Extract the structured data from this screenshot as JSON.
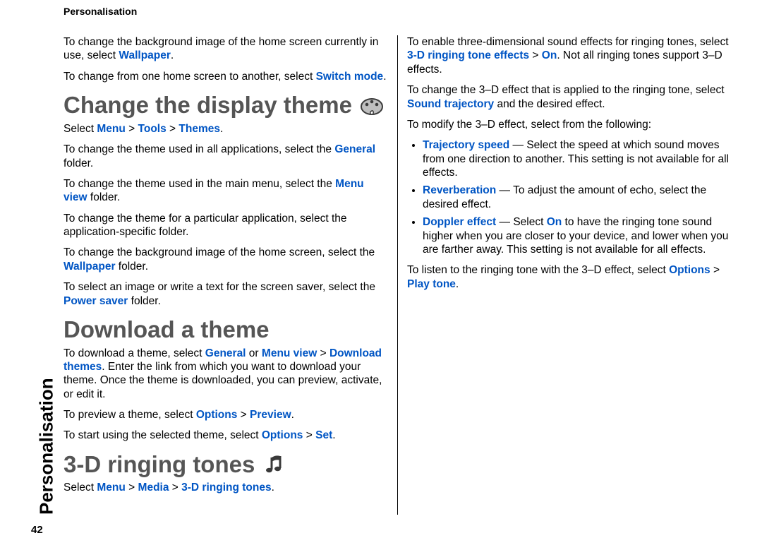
{
  "header": "Personalisation",
  "side_tab": "Personalisation",
  "page_number": "42",
  "intro": {
    "p1a": "To change the background image of the home screen currently in use, select ",
    "p1_link": "Wallpaper",
    "p1b": ".",
    "p2a": "To change from one home screen to another, select ",
    "p2_link": "Switch mode",
    "p2b": "."
  },
  "h1": "Change the display theme",
  "s1": {
    "p1a": "Select ",
    "p1_l1": "Menu",
    "p1_sep": " > ",
    "p1_l2": "Tools",
    "p1_l3": "Themes",
    "p1b": ".",
    "p2a": "To change the theme used in all applications, select the ",
    "p2_l": "General",
    "p2b": " folder.",
    "p3a": "To change the theme used in the main menu, select the ",
    "p3_l": "Menu view",
    "p3b": " folder.",
    "p4": "To change the theme for a particular application, select the application-specific folder.",
    "p5a": "To change the background image of the home screen, select the ",
    "p5_l": "Wallpaper",
    "p5b": " folder.",
    "p6a": "To select an image or write a text for the screen saver, select the ",
    "p6_l": "Power saver",
    "p6b": " folder."
  },
  "h2": "Download a theme",
  "s2": {
    "p1a": "To download a theme, select ",
    "p1_l1": "General",
    "p1_mid": " or ",
    "p1_l2": "Menu view",
    "p1_sep": " > ",
    "p1_l3": "Download themes",
    "p1b": ". Enter the link from which you want to download your theme. Once the theme is downloaded, you can preview, activate, or edit it.",
    "p2a": "To preview a theme, select ",
    "p2_l1": "Options",
    "p2_sep": " > ",
    "p2_l2": "Preview",
    "p2b": ".",
    "p3a": "To start using the selected theme, select ",
    "p3_l1": "Options",
    "p3_sep": " > ",
    "p3_l2": "Set",
    "p3b": "."
  },
  "h3": "3-D ringing tones",
  "s3": {
    "p1a": "Select ",
    "p1_l1": "Menu",
    "p1_sep": " > ",
    "p1_l2": "Media",
    "p1_l3": "3-D ringing tones",
    "p1b": ".",
    "p2a": "To enable three-dimensional sound effects for ringing tones, select ",
    "p2_l1": "3-D ringing tone effects",
    "p2_sep": " > ",
    "p2_l2": "On",
    "p2b": ". Not all ringing tones support 3–D effects.",
    "p3a": "To change the 3–D effect that is applied to the ringing tone, select ",
    "p3_l": "Sound trajectory",
    "p3b": " and the desired effect.",
    "p4": "To modify the 3–D effect, select from the following:",
    "li1_l": "Trajectory speed",
    "li1_b": " — Select the speed at which sound moves from one direction to another. This setting is not available for all effects.",
    "li2_l": "Reverberation",
    "li2_b": " — To adjust the amount of echo, select the desired effect.",
    "li3_l": "Doppler effect",
    "li3_mid": " — Select ",
    "li3_l2": "On",
    "li3_b": " to have the ringing tone sound higher when you are closer to your device, and lower when you are farther away. This setting is not available for all effects.",
    "p5a": "To listen to the ringing tone with the 3–D effect, select ",
    "p5_l1": "Options",
    "p5_sep": " > ",
    "p5_l2": "Play tone",
    "p5b": "."
  }
}
